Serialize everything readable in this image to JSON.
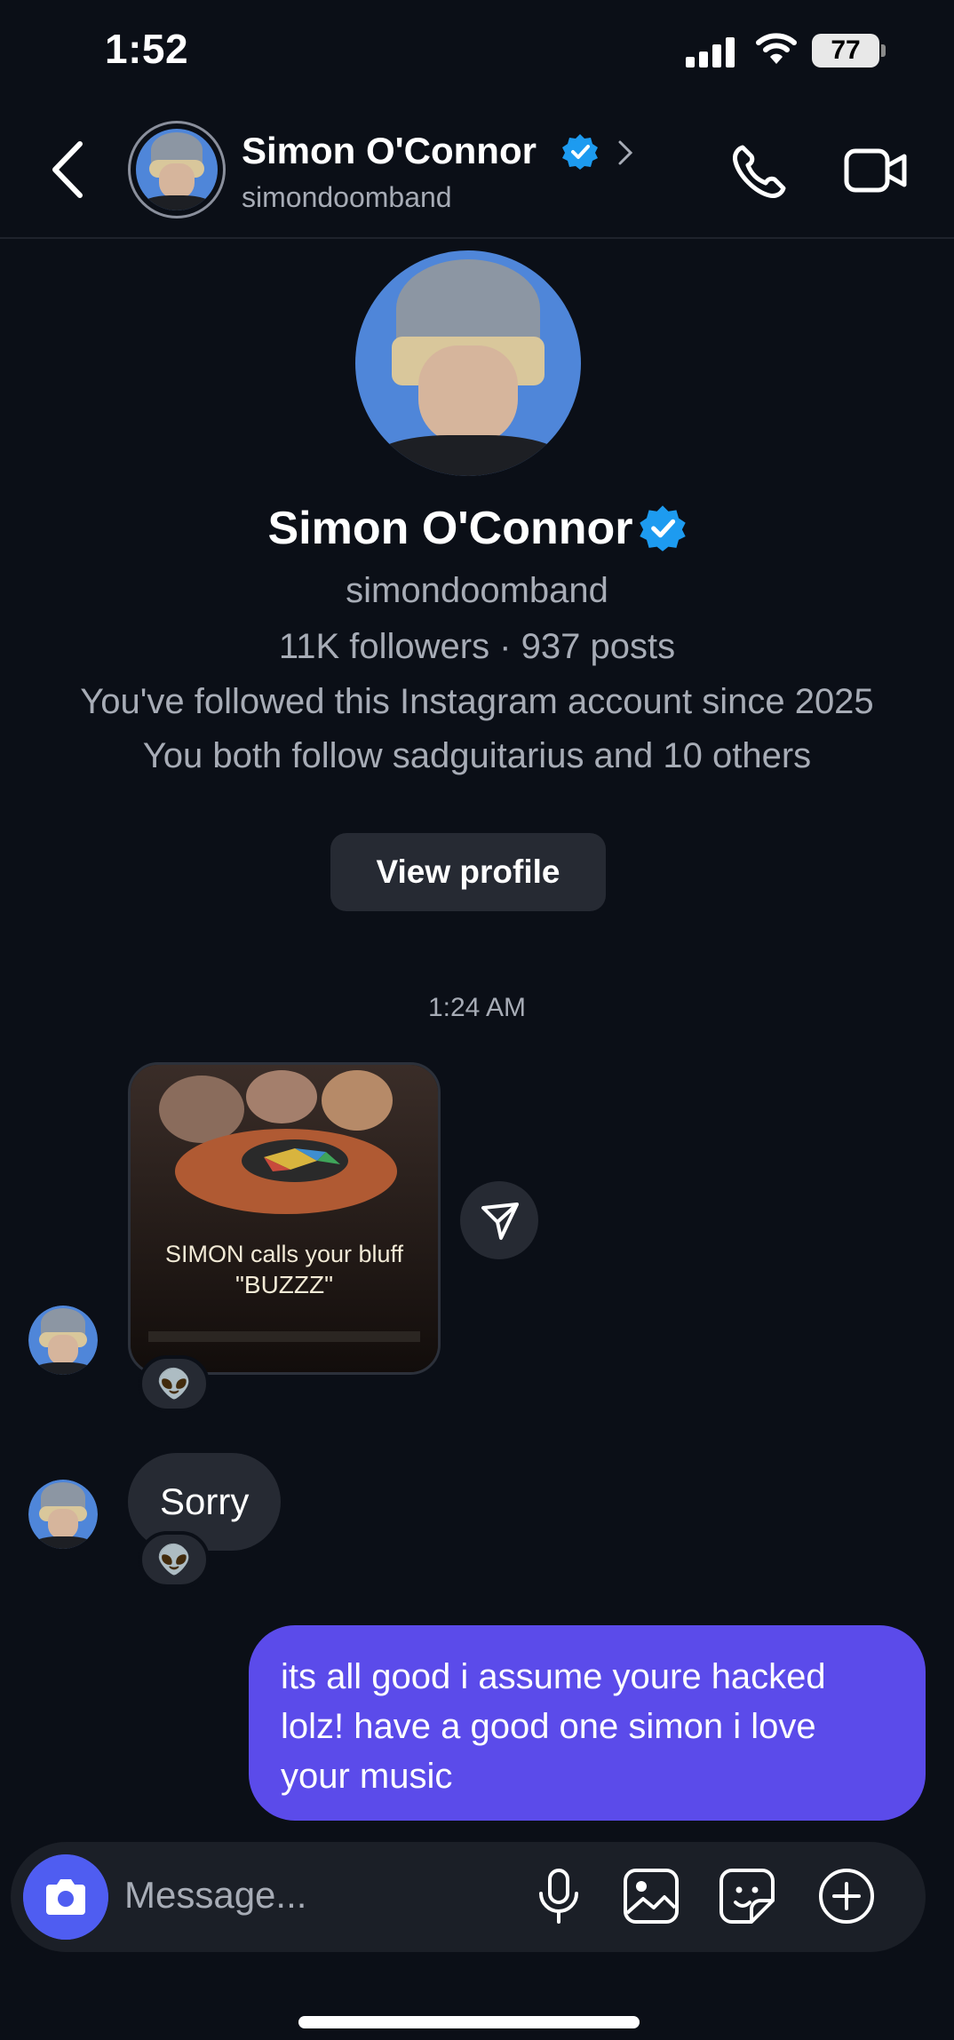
{
  "status_bar": {
    "time": "1:52",
    "battery": "77"
  },
  "header": {
    "name": "Simon O'Connor",
    "username": "simondoomband",
    "icons": [
      "back-arrow-icon",
      "verified-badge-icon",
      "chevron-right-icon",
      "phone-icon",
      "video-camera-icon"
    ]
  },
  "profile": {
    "name": "Simon O'Connor",
    "username": "simondoomband",
    "stats": "11K followers · 937 posts",
    "followed_since": "You've followed this Instagram account since 2025",
    "mutuals": "You both follow sadguitarius and 10 others",
    "view_profile_label": "View profile"
  },
  "conversation": {
    "timestamp": "1:24 AM",
    "messages": [
      {
        "from": "them",
        "type": "photo",
        "caption_line1": "SIMON calls your bluff",
        "caption_line2": "\"BUZZZ\"",
        "reaction": "👽"
      },
      {
        "from": "them",
        "type": "text",
        "text": "Sorry",
        "reaction": "👽"
      },
      {
        "from": "me",
        "type": "text",
        "text": "its all good i assume youre hacked lolz! have a good one simon i love your music"
      }
    ]
  },
  "composer": {
    "placeholder": "Message...",
    "icons": [
      "camera-icon",
      "microphone-icon",
      "gallery-icon",
      "sticker-icon",
      "plus-icon"
    ]
  },
  "colors": {
    "background": "#0b0f17",
    "bubble_incoming": "#262a33",
    "bubble_outgoing": "#5b4bea",
    "verified_blue": "#1d9bf0",
    "camera_button": "#4f5df1"
  }
}
